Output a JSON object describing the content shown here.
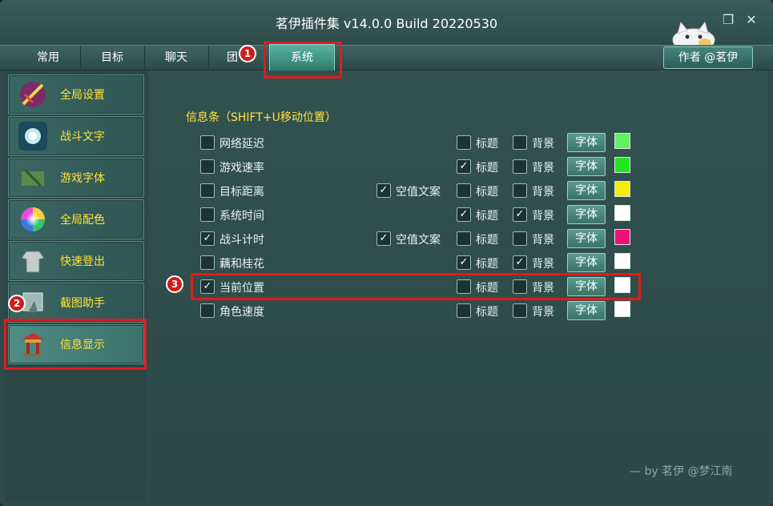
{
  "window": {
    "title": "茗伊插件集 v14.0.0 Build 20220530",
    "author_button": "作者 @茗伊",
    "restore_icon": "window-restore-icon",
    "close_icon": "close-icon"
  },
  "tabs": [
    {
      "label": "常用"
    },
    {
      "label": "目标"
    },
    {
      "label": "聊天"
    },
    {
      "label": "团"
    },
    {
      "label": "系统",
      "active": true
    }
  ],
  "sidebar": {
    "items": [
      {
        "label": "全局设置",
        "icon": "sword-icon"
      },
      {
        "label": "战斗文字",
        "icon": "burst-icon"
      },
      {
        "label": "游戏字体",
        "icon": "scroll-icon"
      },
      {
        "label": "全局配色",
        "icon": "color-wheel-icon"
      },
      {
        "label": "快速登出",
        "icon": "armor-icon"
      },
      {
        "label": "截图助手",
        "icon": "screenshot-icon"
      },
      {
        "label": "信息显示",
        "icon": "pavilion-icon",
        "active": true
      }
    ]
  },
  "content": {
    "section_title": "信息条（SHIFT+U移动位置）",
    "col_title": "标题",
    "col_bg": "背景",
    "font_button": "字体",
    "blank_text_label": "空值文案",
    "rows": [
      {
        "label": "网络延迟",
        "checked": false,
        "blank": null,
        "title": false,
        "bg": false,
        "color": "#5ef05e"
      },
      {
        "label": "游戏速率",
        "checked": false,
        "blank": null,
        "title": true,
        "bg": false,
        "color": "#1ee81e"
      },
      {
        "label": "目标距离",
        "checked": false,
        "blank": true,
        "title": false,
        "bg": false,
        "color": "#f4f000"
      },
      {
        "label": "系统时间",
        "checked": false,
        "blank": null,
        "title": true,
        "bg": true,
        "color": "#ffffff"
      },
      {
        "label": "战斗计时",
        "checked": true,
        "blank": true,
        "title": false,
        "bg": false,
        "color": "#f0107a"
      },
      {
        "label": "藕和桂花",
        "checked": false,
        "blank": null,
        "title": true,
        "bg": true,
        "color": "#ffffff"
      },
      {
        "label": "当前位置",
        "checked": true,
        "blank": null,
        "title": false,
        "bg": false,
        "color": "#ffffff"
      },
      {
        "label": "角色速度",
        "checked": false,
        "blank": null,
        "title": false,
        "bg": false,
        "color": "#ffffff"
      }
    ]
  },
  "annotations": {
    "badge1": "1",
    "badge2": "2",
    "badge3": "3"
  },
  "footer": "— by 茗伊 @梦江南"
}
